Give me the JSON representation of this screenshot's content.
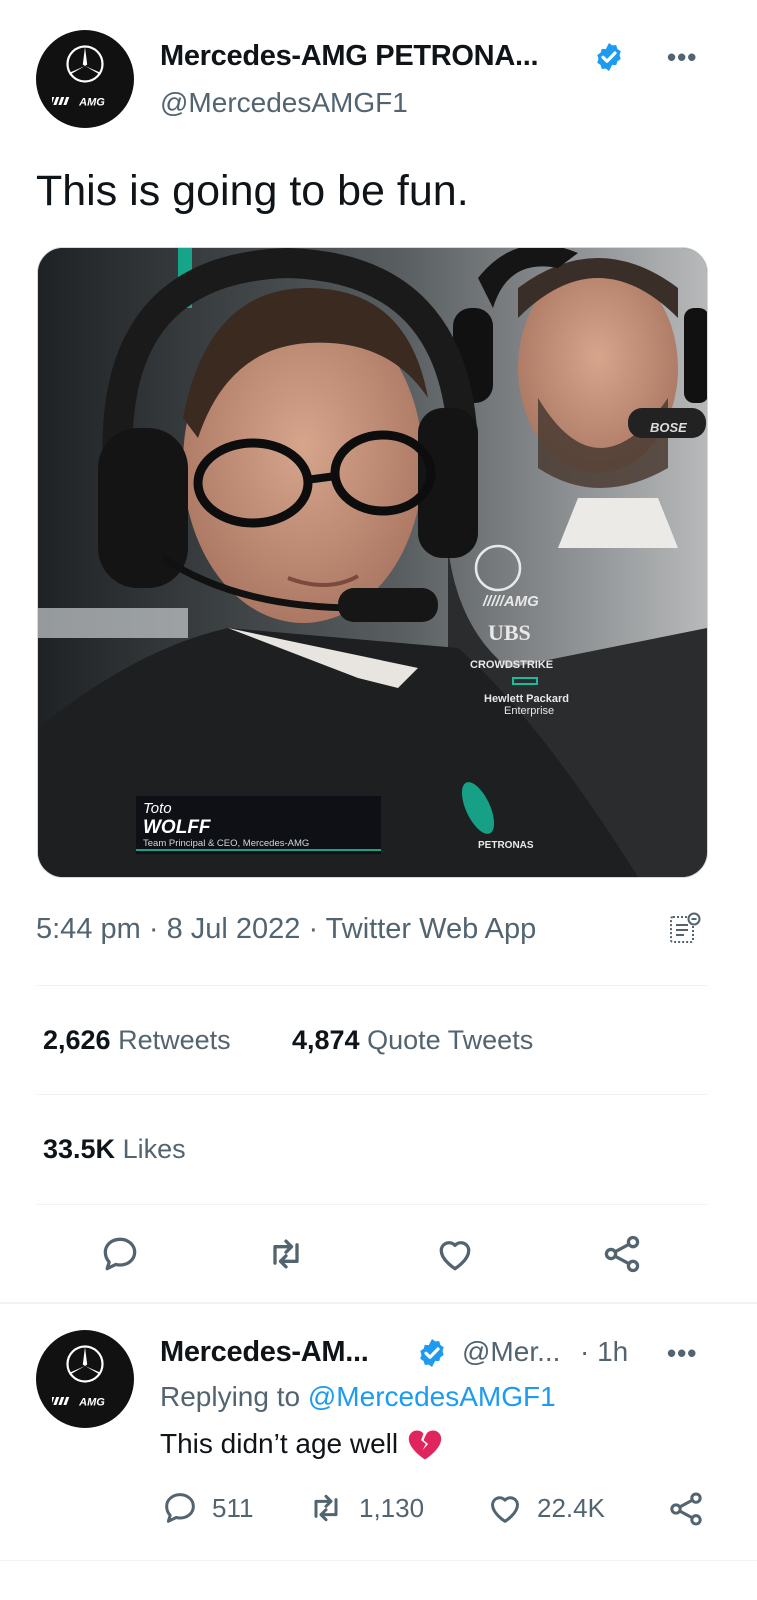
{
  "tweet": {
    "author_name": "Mercedes-AMG PETRONA...",
    "author_handle": "@MercedesAMGF1",
    "text": "This is going to be fun.",
    "photo_caption": {
      "first": "Toto",
      "last": "WOLFF",
      "role": "Team Principal & CEO, Mercedes-AMG"
    },
    "photo_logos": [
      "UBS",
      "CROWDSTRIKE",
      "Hewlett Packard",
      "Enterprise",
      "BOSE",
      "PETRONAS"
    ],
    "time": "5:44 pm",
    "date": "8 Jul 2022",
    "source": "Twitter Web App",
    "retweets_count": "2,626",
    "retweets_label": "Retweets",
    "quotes_count": "4,874",
    "quotes_label": "Quote Tweets",
    "likes_count": "33.5K",
    "likes_label": "Likes",
    "more_label": "•••"
  },
  "reply": {
    "author_name": "Mercedes-AM...",
    "author_handle": "@Mer...",
    "time": "· 1h",
    "replying_prefix": "Replying to",
    "replying_to": "@MercedesAMGF1",
    "text": "This didn’t age well",
    "reply_count": "511",
    "retweet_count": "1,130",
    "like_count": "22.4K",
    "more_label": "•••"
  },
  "avatar_badge": "AMG",
  "colors": {
    "accent": "#1d9bf0",
    "muted": "#536471",
    "text": "#0f1419",
    "broken_heart": "#e0245e"
  },
  "icons": [
    "verified-badge-icon",
    "reply-icon",
    "retweet-icon",
    "like-icon",
    "share-icon",
    "analytics-icon",
    "broken-heart-emoji"
  ]
}
